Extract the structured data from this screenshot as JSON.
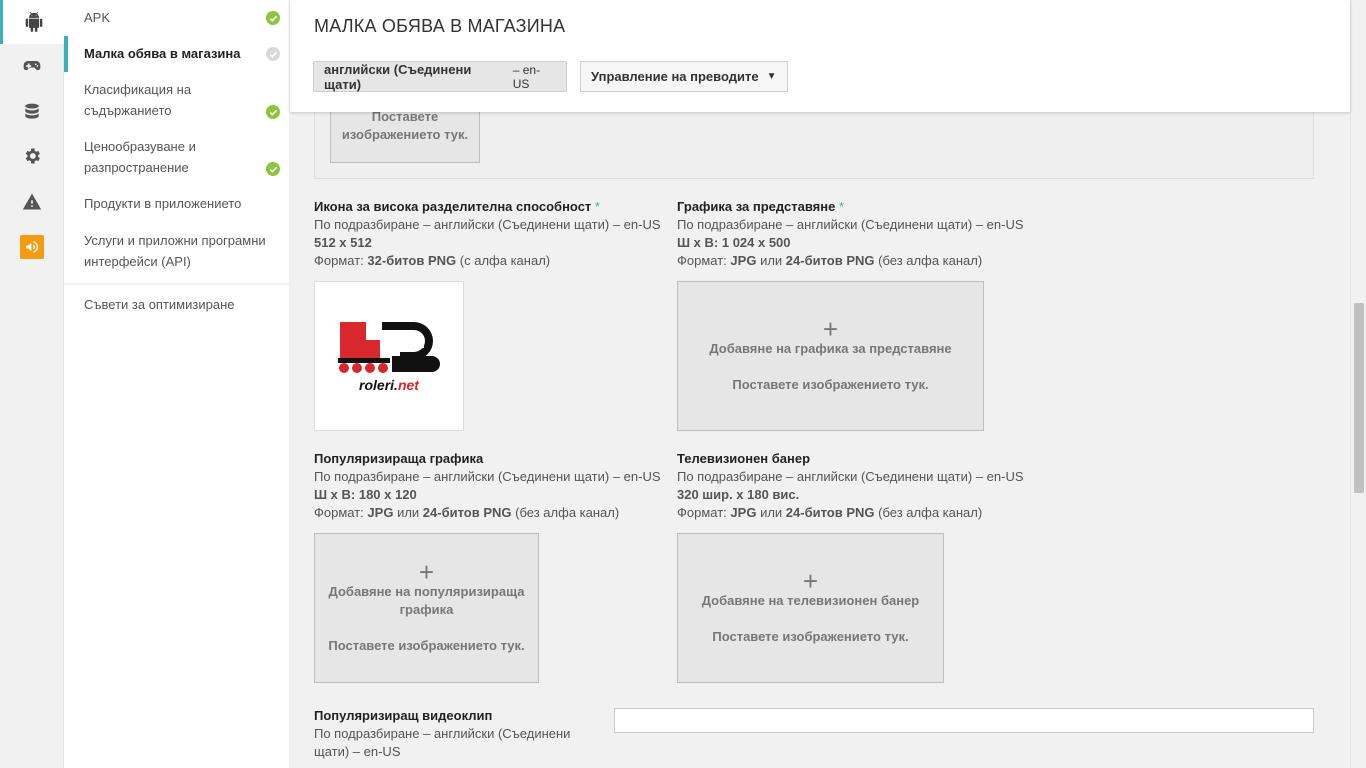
{
  "rail": {
    "items": [
      {
        "icon": "android-icon",
        "active": true
      },
      {
        "icon": "gamepad-icon"
      },
      {
        "icon": "database-icon"
      },
      {
        "icon": "gear-icon"
      },
      {
        "icon": "warning-icon"
      },
      {
        "icon": "megaphone-icon"
      }
    ]
  },
  "sidenav": {
    "apk": "APK",
    "store_listing": "Малка обява в магазина",
    "content_rating": "Класификация на съдържанието",
    "pricing": "Ценообразуване и разпространение",
    "in_app_products": "Продукти в приложението",
    "services_apis": "Услуги и приложни програмни интерфейси (API)",
    "optimization_tips": "Съвети за оптимизиране"
  },
  "header": {
    "title": "МАЛКА ОБЯВА В МАГАЗИНА",
    "language_button": "английски (Съединени щати)",
    "language_code": "– en-US",
    "translations_button": "Управление на преводите"
  },
  "prev_drop": "Поставете изображението тук.",
  "assets": {
    "hires_icon": {
      "title": "Икона за висока разделителна способност",
      "required": "*",
      "default": "По подразбиране – английски (Съединени щати) – en-US",
      "size": "512 x 512",
      "format_prefix": "Формат:",
      "format_bold": "32-битов PNG",
      "format_suffix": "(с алфа канал)",
      "logo_text": "roleri.net"
    },
    "feature_graphic": {
      "title": "Графика за представяне",
      "required": "*",
      "default": "По подразбиране – английски (Съединени щати) – en-US",
      "size": "Ш x В: 1 024 x 500",
      "format_prefix": "Формат:",
      "format_a": "JPG",
      "format_or": "или",
      "format_b": "24-битов PNG",
      "format_suffix": "(без алфа канал)",
      "add": "Добавяне на графика за представяне",
      "drop": "Поставете изображението тук."
    },
    "promo_graphic": {
      "title": "Популяризираща графика",
      "default": "По подразбиране – английски (Съединени щати) – en-US",
      "size": "Ш x В: 180 x 120",
      "format_prefix": "Формат:",
      "format_a": "JPG",
      "format_or": "или",
      "format_b": "24-битов PNG",
      "format_suffix": "(без алфа канал)",
      "add": "Добавяне на популяризираща графика",
      "drop": "Поставете изображението тук."
    },
    "tv_banner": {
      "title": "Телевизионен банер",
      "default": "По подразбиране – английски (Съединени щати) – en-US",
      "size": "320 шир. x 180 вис.",
      "format_prefix": "Формат:",
      "format_a": "JPG",
      "format_or": "или",
      "format_b": "24-битов PNG",
      "format_suffix": "(без алфа канал)",
      "add": "Добавяне на телевизионен банер",
      "drop": "Поставете изображението тук."
    },
    "promo_video": {
      "title": "Популяризиращ видеоклип",
      "default": "По подразбиране – английски (Съединени щати) – en-US",
      "input_value": ""
    }
  },
  "plus": "+",
  "colors": {
    "accent": "#3ab0bc",
    "check": "#8cc63e",
    "warning_tile": "#f39c12"
  }
}
